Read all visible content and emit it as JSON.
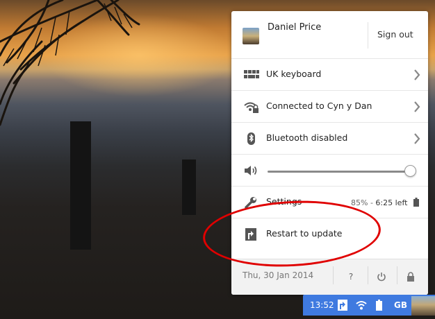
{
  "user": {
    "name": "Daniel Price",
    "sign_out_label": "Sign out"
  },
  "rows": {
    "keyboard": {
      "label": "UK keyboard",
      "icon": "keyboard-icon"
    },
    "network": {
      "label": "Connected to Cyn y Dan",
      "icon": "wifi-locked-icon"
    },
    "bluetooth": {
      "label": "Bluetooth disabled",
      "icon": "bluetooth-icon"
    },
    "volume": {
      "icon": "speaker-icon",
      "level": 0.98
    },
    "settings": {
      "label": "Settings",
      "icon": "wrench-icon",
      "battery_percent": "85%",
      "battery_sep": " - ",
      "battery_time": "6:25 left"
    },
    "update": {
      "label": "Restart to update",
      "icon": "update-arrow-icon"
    }
  },
  "footer": {
    "date": "Thu, 30 Jan 2014",
    "help_label": "?"
  },
  "shelf": {
    "time": "13:52",
    "locale": "GB"
  },
  "colors": {
    "shelf": "#3f7ae0",
    "annotation": "#e00000"
  }
}
